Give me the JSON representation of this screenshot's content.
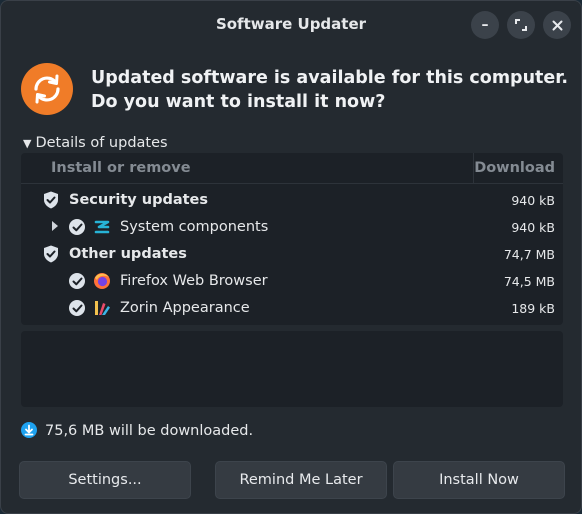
{
  "window": {
    "title": "Software Updater",
    "controls": {
      "minimize": "–",
      "maximize": "⤢",
      "close": "✕"
    }
  },
  "header": {
    "message": "Updated software is available for this computer. Do you want to install it now?",
    "icon": "update-refresh-icon",
    "accent": "#f07c28"
  },
  "details": {
    "expander_label": "Details of updates",
    "columns": {
      "name": "Install or remove",
      "download": "Download"
    },
    "groups": [
      {
        "label": "Security updates",
        "size": "940 kB",
        "items": [
          {
            "label": "System components",
            "size": "940 kB",
            "icon": "system-components-icon"
          }
        ]
      },
      {
        "label": "Other updates",
        "size": "74,7 MB",
        "items": [
          {
            "label": "Firefox Web Browser",
            "size": "74,5 MB",
            "icon": "firefox-icon"
          },
          {
            "label": "Zorin Appearance",
            "size": "189 kB",
            "icon": "zorin-appearance-icon"
          }
        ]
      }
    ]
  },
  "download_info": "75,6 MB will be downloaded.",
  "buttons": {
    "settings": "Settings...",
    "remind": "Remind Me Later",
    "install": "Install Now"
  }
}
